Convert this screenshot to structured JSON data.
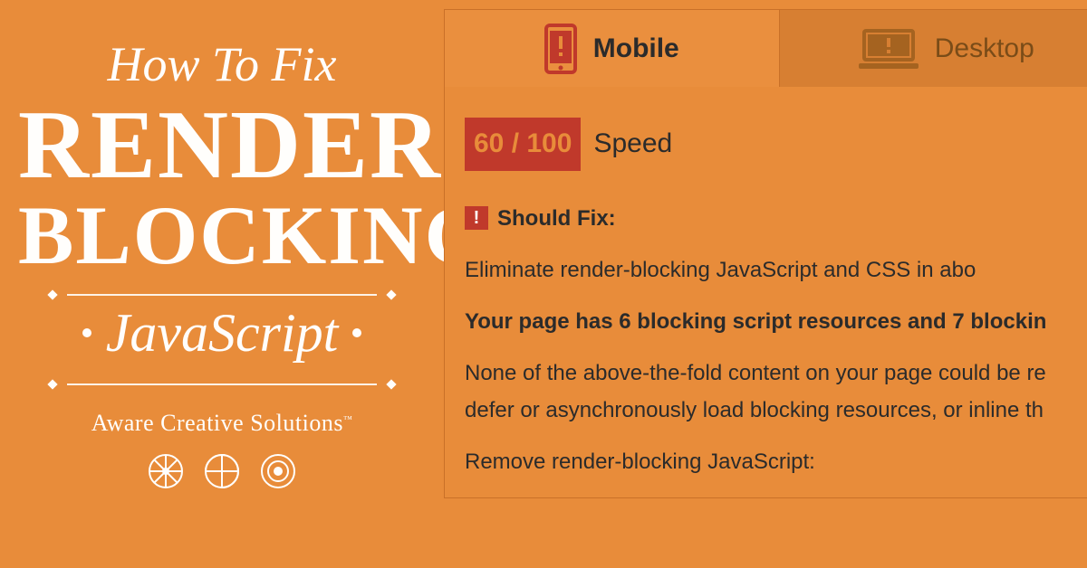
{
  "left": {
    "script_top": "How To Fix",
    "word1": "RENDER",
    "word2": "BLOCKING",
    "script_bot": "JavaScript",
    "brand": "Aware Creative Solutions",
    "tm": "™"
  },
  "tabs": {
    "active": {
      "label": "Mobile"
    },
    "inactive": {
      "label": "Desktop"
    }
  },
  "score": {
    "value": "60 / 100",
    "label": "Speed"
  },
  "shouldfix": {
    "bang": "!",
    "label": "Should Fix:"
  },
  "lines": {
    "l1": "Eliminate render-blocking JavaScript and CSS in abo",
    "l2": "Your page has 6 blocking script resources and 7 blockin",
    "l3a": "None of the above-the-fold content on your page could be re",
    "l3b": "defer or asynchronously load blocking resources, or inline th",
    "l4": "Remove render-blocking JavaScript:"
  }
}
